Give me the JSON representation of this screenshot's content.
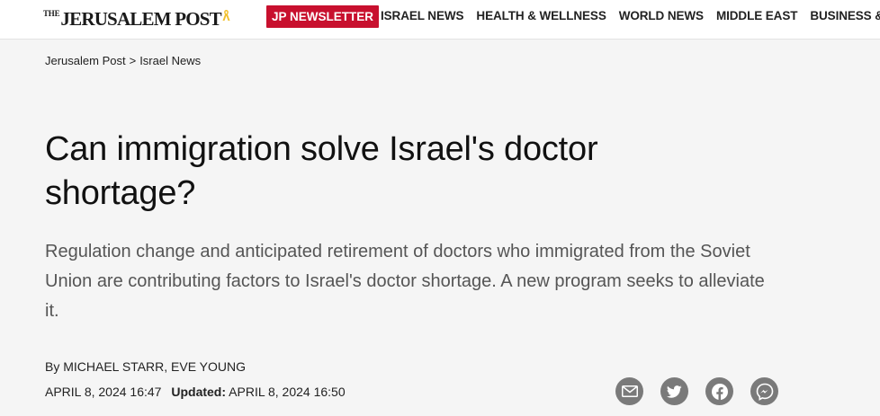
{
  "header": {
    "logo": {
      "the": "THE",
      "name": "JERUSALEM POST"
    },
    "newsletter_label": "JP NEWSLETTER",
    "nav": [
      "ISRAEL NEWS",
      "HEALTH & WELLNESS",
      "WORLD NEWS",
      "MIDDLE EAST",
      "BUSINESS & INNOVATION"
    ]
  },
  "breadcrumb": {
    "home": "Jerusalem Post",
    "separator": ">",
    "section": "Israel News"
  },
  "article": {
    "title": "Can immigration solve Israel's doctor shortage?",
    "subtitle": "Regulation change and anticipated retirement of doctors who immigrated from the Soviet Union are contributing factors to Israel's doctor shortage. A new program seeks to alleviate it.",
    "by_label": "By",
    "authors": "MICHAEL STARR, EVE YOUNG",
    "published": "APRIL 8, 2024 16:47",
    "updated_label": "Updated:",
    "updated": "APRIL 8, 2024 16:50"
  },
  "share": {
    "icons": [
      "email-icon",
      "twitter-icon",
      "facebook-icon",
      "messenger-icon"
    ],
    "icon_color": "#7a7a7a"
  },
  "colors": {
    "brand_red": "#c8102e",
    "ribbon_yellow": "#f2c12e",
    "background": "#f5f5f5"
  }
}
